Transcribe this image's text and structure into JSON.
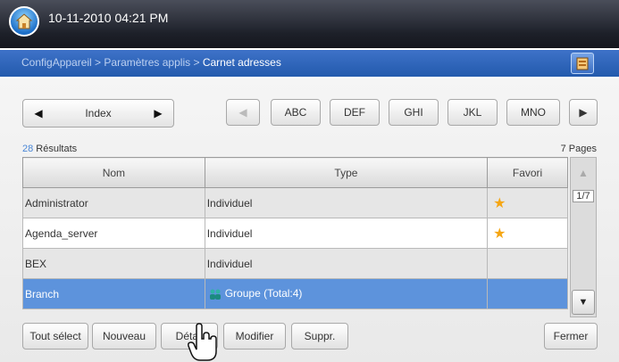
{
  "header": {
    "datetime": "10-11-2010 04:21 PM"
  },
  "breadcrumb": {
    "part1": "ConfigAppareil",
    "sep": " > ",
    "part2": "Paramètres applis",
    "part3": "Carnet adresses"
  },
  "index": {
    "label": "Index",
    "prev": "◀",
    "next": "▶"
  },
  "letters": {
    "prev": "◀",
    "abc": "ABC",
    "def": "DEF",
    "ghi": "GHI",
    "jkl": "JKL",
    "mno": "MNO",
    "next": "▶"
  },
  "summary": {
    "count": "28",
    "results_label": " Résultats",
    "pages": "7 Pages"
  },
  "table": {
    "headers": {
      "name": "Nom",
      "type": "Type",
      "favorite": "Favori"
    },
    "rows": [
      {
        "name": "Administrator",
        "type": "Individuel",
        "favorite": true
      },
      {
        "name": "Agenda_server",
        "type": "Individuel",
        "favorite": true
      },
      {
        "name": "BEX",
        "type": "Individuel",
        "favorite": false
      },
      {
        "name": "Branch",
        "type": "Groupe (Total:4)",
        "favorite": false
      }
    ]
  },
  "scroll": {
    "page": "1/7"
  },
  "actions": {
    "select_all": "Tout sélect",
    "new": "Nouveau",
    "detail": "Détail",
    "modify": "Modifier",
    "delete": "Suppr.",
    "close": "Fermer"
  },
  "icons": {
    "home": "home-icon",
    "star": "star-icon",
    "group": "group-icon",
    "book": "address-book-icon"
  }
}
